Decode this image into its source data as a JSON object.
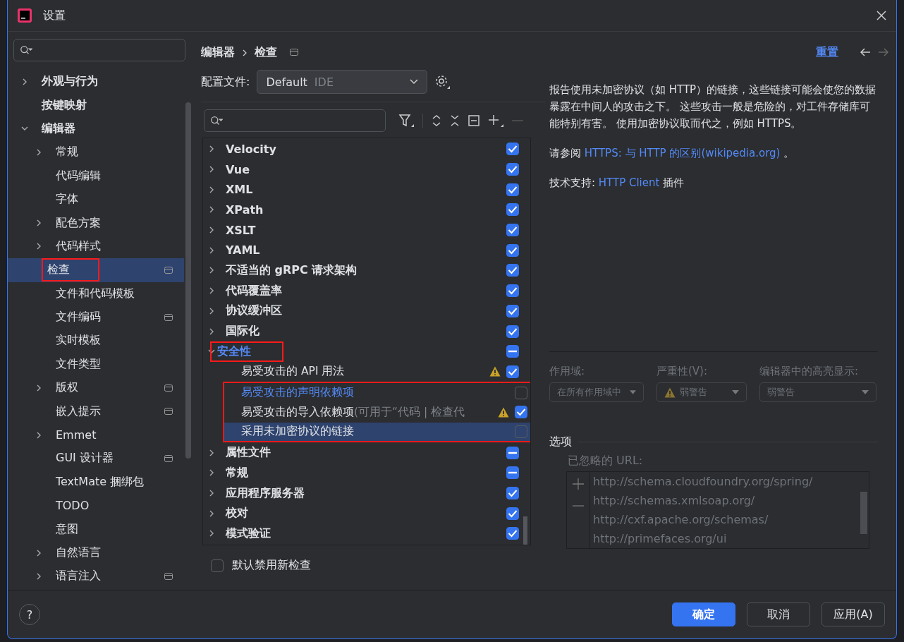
{
  "window": {
    "title": "设置"
  },
  "sidebar": {
    "items": [
      {
        "label": "外观与行为",
        "expanded": false,
        "selected": false,
        "project_scope": false,
        "marked": false
      },
      {
        "label": "按键映射",
        "selected": false,
        "project_scope": false,
        "marked": false
      },
      {
        "label": "编辑器",
        "expanded": true,
        "selected": false,
        "project_scope": false,
        "marked": false,
        "children": [
          {
            "label": "常规",
            "expanded": false,
            "selected": false,
            "project_scope": false,
            "marked": false
          },
          {
            "label": "代码编辑",
            "selected": false,
            "project_scope": false,
            "marked": false
          },
          {
            "label": "字体",
            "selected": false,
            "project_scope": false,
            "marked": false
          },
          {
            "label": "配色方案",
            "expanded": false,
            "selected": false,
            "project_scope": false,
            "marked": false
          },
          {
            "label": "代码样式",
            "expanded": false,
            "selected": false,
            "project_scope": false,
            "marked": false
          },
          {
            "label": "检查",
            "selected": true,
            "project_scope": true,
            "marked": true
          },
          {
            "label": "文件和代码模板",
            "selected": false,
            "project_scope": false,
            "marked": false
          },
          {
            "label": "文件编码",
            "selected": false,
            "project_scope": true,
            "marked": false
          },
          {
            "label": "实时模板",
            "selected": false,
            "project_scope": false,
            "marked": false
          },
          {
            "label": "文件类型",
            "selected": false,
            "project_scope": false,
            "marked": false
          },
          {
            "label": "版权",
            "expanded": false,
            "selected": false,
            "project_scope": true,
            "marked": false
          },
          {
            "label": "嵌入提示",
            "selected": false,
            "project_scope": true,
            "marked": false
          },
          {
            "label": "Emmet",
            "expanded": false,
            "selected": false,
            "project_scope": false,
            "marked": false
          },
          {
            "label": "GUI 设计器",
            "selected": false,
            "project_scope": true,
            "marked": false
          },
          {
            "label": "TextMate 捆绑包",
            "selected": false,
            "project_scope": false,
            "marked": false
          },
          {
            "label": "TODO",
            "selected": false,
            "project_scope": false,
            "marked": false
          },
          {
            "label": "意图",
            "selected": false,
            "project_scope": false,
            "marked": false
          },
          {
            "label": "自然语言",
            "expanded": false,
            "selected": false,
            "project_scope": false,
            "marked": false
          },
          {
            "label": "语言注入",
            "expanded": false,
            "selected": false,
            "project_scope": true,
            "marked": false
          }
        ]
      }
    ]
  },
  "header": {
    "breadcrumb": [
      "编辑器",
      "检查"
    ],
    "reset": "重置"
  },
  "profile": {
    "label": "配置文件:",
    "value": "Default",
    "hint": "IDE"
  },
  "inspections": {
    "items": [
      {
        "label": "Velocity",
        "checked": true,
        "partial": false,
        "expanded": false,
        "selected": false,
        "modified": false,
        "marked": false
      },
      {
        "label": "Vue",
        "checked": true,
        "partial": false,
        "expanded": false,
        "selected": false,
        "modified": false,
        "marked": false
      },
      {
        "label": "XML",
        "checked": true,
        "partial": false,
        "expanded": false,
        "selected": false,
        "modified": false,
        "marked": false
      },
      {
        "label": "XPath",
        "checked": true,
        "partial": false,
        "expanded": false,
        "selected": false,
        "modified": false,
        "marked": false
      },
      {
        "label": "XSLT",
        "checked": true,
        "partial": false,
        "expanded": false,
        "selected": false,
        "modified": false,
        "marked": false
      },
      {
        "label": "YAML",
        "checked": true,
        "partial": false,
        "expanded": false,
        "selected": false,
        "modified": false,
        "marked": false
      },
      {
        "label": "不适当的 gRPC 请求架构",
        "checked": true,
        "partial": false,
        "expanded": false,
        "selected": false,
        "modified": false,
        "marked": false
      },
      {
        "label": "代码覆盖率",
        "checked": true,
        "partial": false,
        "expanded": false,
        "selected": false,
        "modified": false,
        "marked": false
      },
      {
        "label": "协议缓冲区",
        "checked": true,
        "partial": false,
        "expanded": false,
        "selected": false,
        "modified": false,
        "marked": false
      },
      {
        "label": "国际化",
        "checked": true,
        "partial": false,
        "expanded": false,
        "selected": false,
        "modified": false,
        "marked": false
      },
      {
        "label": "安全性",
        "checked": true,
        "partial": true,
        "expanded": true,
        "selected": false,
        "modified": true,
        "marked": true,
        "children": [
          {
            "label": "易受攻击的 API 用法",
            "checked": true,
            "partial": false,
            "warning": true,
            "selected": false,
            "modified": false,
            "marked": false
          },
          {
            "label": "易受攻击的声明依赖项",
            "checked": false,
            "warning": false,
            "selected": false,
            "modified": true,
            "marked": true
          },
          {
            "label": "易受攻击的导入依赖项",
            "hint": "(可用于“代码 | 检查代",
            "checked": true,
            "partial": false,
            "warning": true,
            "selected": false,
            "modified": false,
            "marked": true
          },
          {
            "label": "采用未加密协议的链接",
            "checked": false,
            "warning": false,
            "selected": true,
            "modified": false,
            "marked": true
          }
        ]
      },
      {
        "label": "属性文件",
        "checked": true,
        "partial": true,
        "expanded": false,
        "selected": false,
        "modified": false,
        "marked": false
      },
      {
        "label": "常规",
        "checked": true,
        "partial": true,
        "expanded": false,
        "selected": false,
        "modified": false,
        "marked": false
      },
      {
        "label": "应用程序服务器",
        "checked": true,
        "partial": false,
        "expanded": false,
        "selected": false,
        "modified": false,
        "marked": false
      },
      {
        "label": "校对",
        "checked": true,
        "partial": false,
        "expanded": false,
        "selected": false,
        "modified": false,
        "marked": false
      },
      {
        "label": "模式验证",
        "checked": true,
        "partial": false,
        "expanded": false,
        "selected": false,
        "modified": false,
        "marked": false
      }
    ]
  },
  "disable_new": {
    "label": "默认禁用新检查",
    "checked": false
  },
  "description": {
    "paragraph": "报告使用未加密协议（如 HTTP）的链接，这些链接可能会使您的数据暴露在中间人的攻击之下。 这些攻击一般是危险的，对工件存储库可能特别有害。 使用加密协议取而代之，例如 HTTPS。",
    "see_also": {
      "prefix": "请参阅",
      "link": "HTTPS: 与 HTTP 的区别(wikipedia.org)",
      "suffix": "。"
    },
    "support": {
      "prefix": "技术支持:",
      "link": "HTTP Client",
      "suffix": "插件"
    }
  },
  "settings": [
    {
      "label": "作用域:",
      "value": "在所有作用域中",
      "warning": false
    },
    {
      "label": "严重性(V):",
      "value": "弱警告",
      "warning": true
    },
    {
      "label": "编辑器中的高亮显示:",
      "value": "弱警告",
      "warning": false
    }
  ],
  "options": {
    "title": "选项",
    "ignored_label": "已忽略的 URL:",
    "urls": [
      "http://schema.cloudfoundry.org/spring/",
      "http://schemas.xmlsoap.org/",
      "http://cxf.apache.org/schemas/",
      "http://primefaces.org/ui"
    ]
  },
  "footer": {
    "help": "?",
    "buttons": [
      {
        "label": "确定",
        "kind": "primary"
      },
      {
        "label": "取消",
        "kind": "normal"
      },
      {
        "label": "应用(A)",
        "kind": "normal"
      }
    ]
  }
}
